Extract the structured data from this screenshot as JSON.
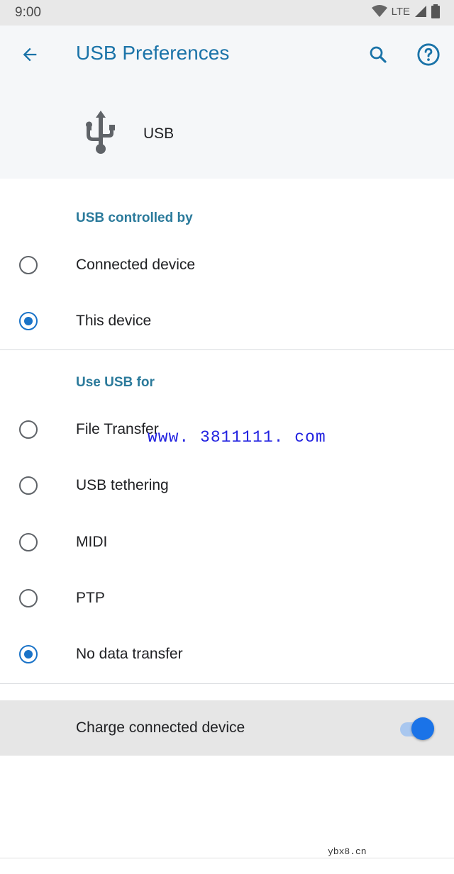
{
  "status_bar": {
    "time": "9:00",
    "network": "LTE"
  },
  "app_bar": {
    "title": "USB Preferences"
  },
  "header": {
    "device_label": "USB"
  },
  "controlled_by": {
    "heading": "USB controlled by",
    "options": [
      {
        "label": "Connected device",
        "selected": false
      },
      {
        "label": "This device",
        "selected": true
      }
    ]
  },
  "use_usb_for": {
    "heading": "Use USB for",
    "options": [
      {
        "label": "File Transfer",
        "selected": false
      },
      {
        "label": "USB tethering",
        "selected": false
      },
      {
        "label": "MIDI",
        "selected": false
      },
      {
        "label": "PTP",
        "selected": false
      },
      {
        "label": "No data transfer",
        "selected": true
      }
    ]
  },
  "charge": {
    "label": "Charge connected device",
    "enabled": true
  },
  "watermarks": {
    "center": "www. 3811111. com",
    "corner": "ybx8.cn"
  },
  "colors": {
    "accent": "#1a73c8",
    "title": "#1a73a8",
    "section": "#2b7a9b"
  }
}
